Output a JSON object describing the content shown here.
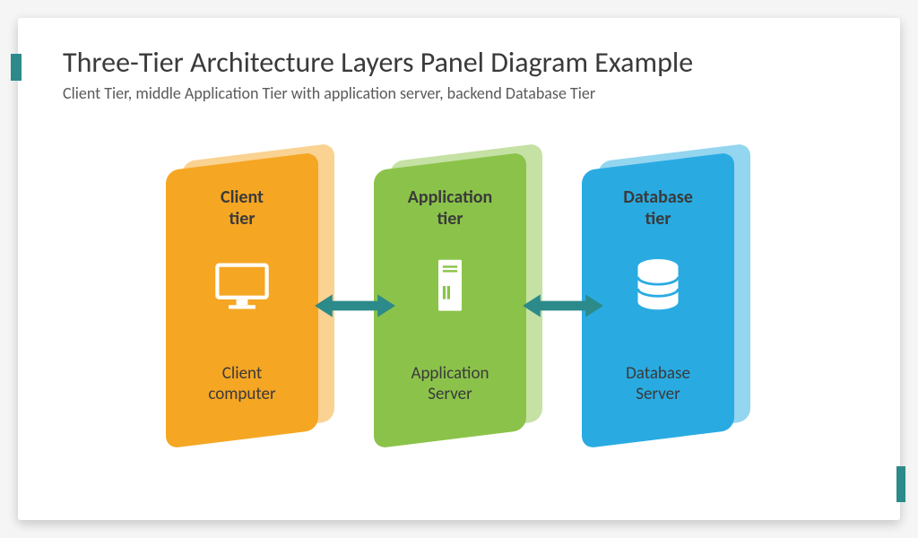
{
  "header": {
    "title": "Three-Tier Architecture Layers Panel Diagram Example",
    "subtitle": "Client Tier, middle Application Tier with application server, backend Database Tier"
  },
  "tiers": [
    {
      "title": "Client\ntier",
      "caption": "Client\ncomputer",
      "color": "orange",
      "icon": "monitor"
    },
    {
      "title": "Application\ntier",
      "caption": "Application\nServer",
      "color": "green",
      "icon": "server"
    },
    {
      "title": "Database\ntier",
      "caption": "Database\nServer",
      "color": "blue",
      "icon": "database"
    }
  ],
  "colors": {
    "orange": "#f5a623",
    "green": "#8bc34a",
    "blue": "#29abe2",
    "arrow": "#2c8a8a",
    "text_dark": "#3a3a3a"
  }
}
